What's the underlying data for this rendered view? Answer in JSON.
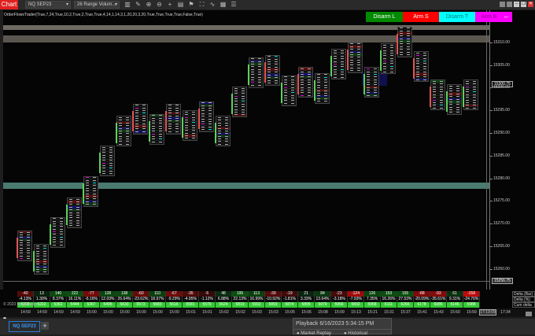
{
  "toolbar": {
    "chart_label": "Chart",
    "instrument": "NQ SEP23",
    "bar_type": "26 Range Volum...",
    "icons": [
      "bars-icon",
      "pencil-icon",
      "zoom-in-icon",
      "zoom-out-icon",
      "crosshair-icon",
      "properties-icon",
      "flag-icon",
      "strategy-icon",
      "indicator-icon",
      "calculator-icon",
      "list-icon"
    ]
  },
  "indicator_label": "OrderFlowsTrader(True,7,24,True,10,2,True,2,True,True,4,14,1,14,3,1,20,20,3,20,True,True,True,True,False,True)",
  "buttons": [
    {
      "label": "Disarm L",
      "bg": "#008a00",
      "fg": "#ffffff"
    },
    {
      "label": "Arm S",
      "bg": "#ff0000",
      "fg": "#ffffff"
    },
    {
      "label": "Disarm T",
      "bg": "#00ffff",
      "fg": "#0a7a7a"
    },
    {
      "label": "Arm B",
      "bg": "#ff00ff",
      "fg": "#880088"
    }
  ],
  "price_axis": {
    "ticks": [
      "15315.00",
      "15310.00",
      "15305.00",
      "15300.00",
      "15295.00",
      "15290.00",
      "15285.00",
      "15280.00",
      "15275.00",
      "15270.00",
      "15265.00",
      "15260.00"
    ],
    "last_price": "15300.75",
    "cursor_price": "15256.75"
  },
  "bars": [
    {
      "high": 15268.5,
      "dir": "down"
    },
    {
      "high": 15265.5,
      "dir": "up"
    },
    {
      "high": 15271.5,
      "dir": "up"
    },
    {
      "high": 15275.75,
      "dir": "up"
    },
    {
      "high": 15280.5,
      "dir": "up"
    },
    {
      "high": 15287.25,
      "dir": "up"
    },
    {
      "high": 15293.75,
      "dir": "up"
    },
    {
      "high": 15296.5,
      "dir": "down"
    },
    {
      "high": 15294.25,
      "dir": "up"
    },
    {
      "high": 15296.5,
      "dir": "down"
    },
    {
      "high": 15295,
      "dir": "up"
    },
    {
      "high": 15297,
      "dir": "down"
    },
    {
      "high": 15293.75,
      "dir": "up"
    },
    {
      "high": 15300.25,
      "dir": "up"
    },
    {
      "high": 15306.75,
      "dir": "up"
    },
    {
      "high": 15307.25,
      "dir": "down"
    },
    {
      "high": 15302.75,
      "dir": "up"
    },
    {
      "high": 15304.5,
      "dir": "down"
    },
    {
      "high": 15303.25,
      "dir": "up"
    },
    {
      "high": 15308.5,
      "dir": "up"
    },
    {
      "high": 15310,
      "dir": "down"
    },
    {
      "high": 15304.5,
      "dir": "up"
    },
    {
      "high": 15309.75,
      "dir": "up"
    },
    {
      "high": 15313.5,
      "dir": "down"
    },
    {
      "high": 15308,
      "dir": "down"
    },
    {
      "high": 15301.75,
      "dir": "down"
    },
    {
      "high": 15300.75,
      "dir": "up"
    },
    {
      "high": 15301.75,
      "dir": "up"
    }
  ],
  "delta_table": {
    "labels": [
      "Delta (Bar)",
      "Delta (%)",
      "Cum delta"
    ],
    "delta": [
      "-40",
      "13",
      "140",
      "222",
      "-77",
      "128",
      "138",
      "-60",
      "110",
      "-67",
      "-35",
      "-5",
      "48",
      "195",
      "113",
      "-39",
      "-19",
      "21",
      "84",
      "-23",
      "-124",
      "126",
      "153",
      "155",
      "-88",
      "-93",
      "61",
      "-158"
    ],
    "percent": [
      "-4.13%",
      "1.30%",
      "8.37%",
      "16.11%",
      "-6.16%",
      "12.03%",
      "26.64%",
      "-23.62%",
      "18.97%",
      "-9.29%",
      "-4.95%",
      "-1.12%",
      "6.88%",
      "22.13%",
      "16.99%",
      "-10.92%",
      "-1.81%",
      "3.33%",
      "13.64%",
      "-3.18%",
      "-7.93%",
      "7.35%",
      "16.26%",
      "27.53%",
      "-20.09%",
      "-35.61%",
      "9.31%",
      "-24.76%"
    ],
    "cum": [
      "5209",
      "5222",
      "5362",
      "5444",
      "5367",
      "5495",
      "5633",
      "5573",
      "5683",
      "5616",
      "5581",
      "5576",
      "5624",
      "5819",
      "5932",
      "5893",
      "5874",
      "5895",
      "5979",
      "5956",
      "5832",
      "5958",
      "6111",
      "6266",
      "6178",
      "6085",
      "6146",
      "5988"
    ]
  },
  "copyright": "© 2023 NinjaTrader",
  "time_axis": {
    "labels": [
      "14:59",
      "14:59",
      "14:59",
      "14:59",
      "15:00",
      "15:00",
      "15:00",
      "15:00",
      "15:00",
      "15:00",
      "15:01",
      "15:01",
      "15:02",
      "15:02",
      "15:03",
      "15:03",
      "15:05",
      "15:06",
      "15:08",
      "15:09",
      "15:13",
      "15:21",
      "15:31",
      "15:37",
      "15:41",
      "15:43",
      "15:50",
      "15:59"
    ],
    "cursor_time": "17:19:09",
    "next_time": "17:34"
  },
  "tabs": {
    "active": "NQ SEP23",
    "add": "+"
  },
  "playback": {
    "title": "Playback 6/16/2023 5:34:15 PM",
    "options": [
      "Market Replay",
      "Historical"
    ]
  }
}
